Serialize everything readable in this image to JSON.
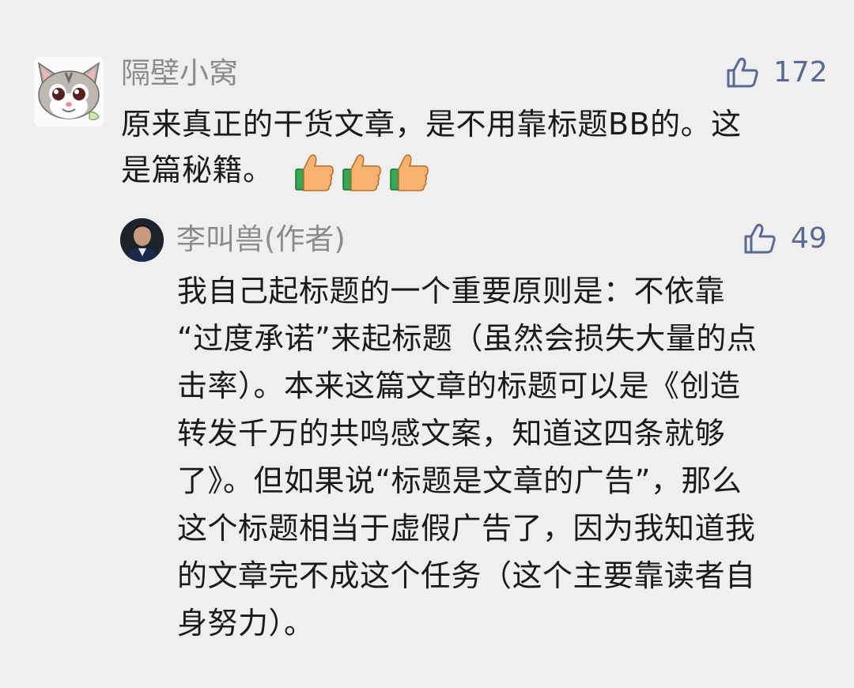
{
  "comment": {
    "username": "隔壁小窝",
    "likes": "172",
    "text_lines": [
      "原来真正的干货文章，是不用靠标题BB的。这",
      "是篇秘籍。"
    ],
    "emoji_count": 3
  },
  "reply": {
    "username": "李叫兽(作者)",
    "likes": "49",
    "text_lines": [
      "我自己起标题的一个重要原则是：不依靠",
      "“过度承诺”来起标题（虽然会损失大量的点",
      "击率）。本来这篇文章的标题可以是《创造",
      "转发千万的共鸣感文案，知道这四条就够",
      "了》。但如果说“标题是文章的广告”，那么",
      "这个标题相当于虚假广告了，因为我知道我",
      "的文章完不成这个任务（这个主要靠读者自",
      "身努力）。"
    ]
  },
  "colors": {
    "background": "#efefef",
    "username": "#8c8c8c",
    "like": "#586a94",
    "text": "#1a1a1a"
  }
}
